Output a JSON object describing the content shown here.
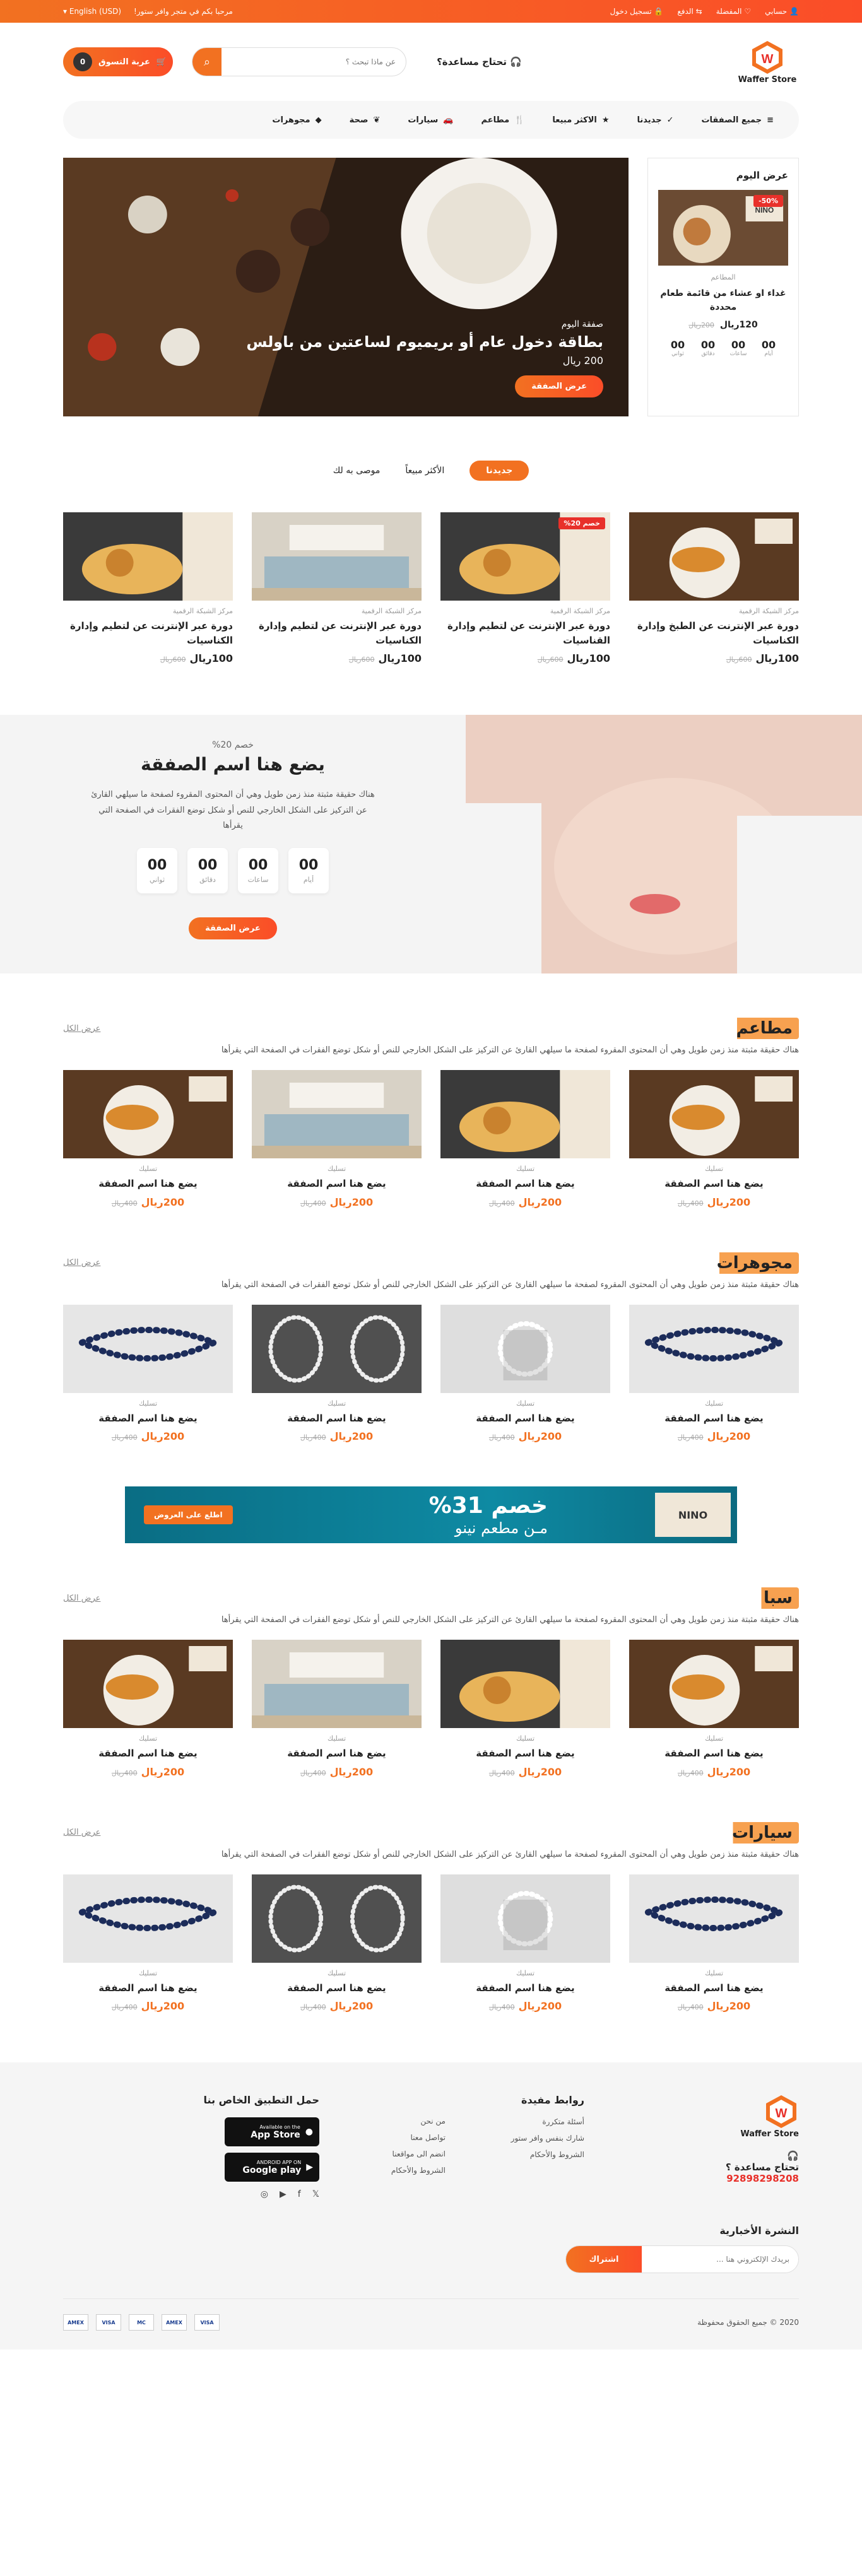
{
  "topbar": {
    "account": "حسابي",
    "favorites": "المفضلة",
    "pay": "الدفع",
    "login": "تسجيل دخول",
    "welcome": "مرحبا بكم في متجر وافر ستور!",
    "currency": "English (USD)"
  },
  "header": {
    "logo_text": "Waffer Store",
    "help": "تحتاج مساعدة؟",
    "search_placeholder": "عن ماذا تبحث ؟",
    "cart_label": "عربة التسوق",
    "cart_count": "0"
  },
  "nav": {
    "items": [
      {
        "label": "جميع الصفقات",
        "icon": "menu-icon"
      },
      {
        "label": "جديدنا",
        "icon": "check-icon"
      },
      {
        "label": "الاكثر مبيعا",
        "icon": "star-icon"
      },
      {
        "label": "مطاعم",
        "icon": "fork-knife-icon"
      },
      {
        "label": "سيارات",
        "icon": "car-icon"
      },
      {
        "label": "صحة",
        "icon": "leaf-icon"
      },
      {
        "label": "مجوهرات",
        "icon": "diamond-icon"
      }
    ]
  },
  "hero": {
    "offer_title": "عرض اليوم",
    "badge": "50%-",
    "offer_category": "المطاعم",
    "offer_name": "غداء او عشاء من قائمة طعام محددة",
    "offer_price": "120ريال",
    "offer_old": "200ريال",
    "countdown": [
      {
        "v": "00",
        "l": "أيام"
      },
      {
        "v": "00",
        "l": "ساعات"
      },
      {
        "v": "00",
        "l": "دقائق"
      },
      {
        "v": "00",
        "l": "ثواني"
      }
    ],
    "kicker": "صفقة اليوم",
    "headline": "بطاقة دخول عام أو بريميوم لساعتين من باولس",
    "price": "200 ريال",
    "button": "عرض الصفقة"
  },
  "tabs": [
    "جديدنا",
    "الأكثر مبيعاً",
    "موصى به لك"
  ],
  "featured": [
    {
      "cat": "مركز الشبكة الرقمية",
      "title": "دورة عبر الإنترنت عن الطبخ وإدارة الكناسيات",
      "price": "100ريال",
      "old": "600ريال",
      "badge": ""
    },
    {
      "cat": "مركز الشبكة الرقمية",
      "title": "دورة عبر الإنترنت عن لتطيم وإدارة القناسيات",
      "price": "100ريال",
      "old": "600ريال",
      "badge": "خصم 20%"
    },
    {
      "cat": "مركز الشبكة الرقمية",
      "title": "دورة عبر الإنترنت عن لتطيم وإدارة الكناسيات",
      "price": "100ريال",
      "old": "600ريال",
      "badge": ""
    },
    {
      "cat": "مركز الشبكة الرقمية",
      "title": "دورة عبر الإنترنت عن لتطيم وإدارة الكناسيات",
      "price": "100ريال",
      "old": "600ريال",
      "badge": ""
    }
  ],
  "deal": {
    "kicker": "خصم 20%",
    "title": "يضع هنا اسم الصفقة",
    "desc": "هناك حقيقة مثبتة منذ زمن طويل وهي أن المحتوى المقروء لصفحة ما سيلهي القارئ عن التركيز على الشكل الخارجي للنص أو شكل توضع الفقرات في الصفحة التي يقرأها",
    "countdown": [
      {
        "v": "00",
        "l": "أيام"
      },
      {
        "v": "00",
        "l": "ساعات"
      },
      {
        "v": "00",
        "l": "دقائق"
      },
      {
        "v": "00",
        "l": "ثواني"
      }
    ],
    "button": "عرض الصفقة"
  },
  "sections": [
    {
      "title": "مطاعم",
      "all": "عرض الكل",
      "desc": "هناك حقيقة مثبتة منذ زمن طويل وهي أن المحتوى المقروء لصفحة ما سيلهي القارئ عن التركيز على الشكل الخارجي للنص أو شكل توضع الفقرات في الصفحة التي يقرأها",
      "kind": "food",
      "items": [
        {
          "cat": "تسليك",
          "title": "يضع هنا اسم الصفقة",
          "price": "200ريال",
          "old": "400ريال"
        },
        {
          "cat": "تسليك",
          "title": "يضع هنا اسم الصفقة",
          "price": "200ريال",
          "old": "400ريال"
        },
        {
          "cat": "تسليك",
          "title": "يضع هنا اسم الصفقة",
          "price": "200ريال",
          "old": "400ريال"
        },
        {
          "cat": "تسليك",
          "title": "يضع هنا اسم الصفقة",
          "price": "200ريال",
          "old": "400ريال"
        }
      ]
    },
    {
      "title": "مجوهرات",
      "all": "عرض الكل",
      "desc": "هناك حقيقة مثبتة منذ زمن طويل وهي أن المحتوى المقروء لصفحة ما سيلهي القارئ عن التركيز على الشكل الخارجي للنص أو شكل توضع الفقرات في الصفحة التي يقرأها",
      "kind": "jewel",
      "items": [
        {
          "cat": "تسليك",
          "title": "يضع هنا اسم الصفقة",
          "price": "200ريال",
          "old": "400ريال"
        },
        {
          "cat": "تسليك",
          "title": "يضع هنا اسم الصفقة",
          "price": "200ريال",
          "old": "400ريال"
        },
        {
          "cat": "تسليك",
          "title": "يضع هنا اسم الصفقة",
          "price": "200ريال",
          "old": "400ريال"
        },
        {
          "cat": "تسليك",
          "title": "يضع هنا اسم الصفقة",
          "price": "200ريال",
          "old": "400ريال"
        }
      ]
    }
  ],
  "banner": {
    "title": "خصم 31%",
    "sub": "مـن مطعم نينو",
    "button": "اطلع على العروض",
    "logo": "NINO"
  },
  "sections2": [
    {
      "title": "سبا",
      "all": "عرض الكل",
      "desc": "هناك حقيقة مثبتة منذ زمن طويل وهي أن المحتوى المقروء لصفحة ما سيلهي القارئ عن التركيز على الشكل الخارجي للنص أو شكل توضع الفقرات في الصفحة التي يقرأها",
      "kind": "food",
      "items": [
        {
          "cat": "تسليك",
          "title": "يضع هنا اسم الصفقة",
          "price": "200ريال",
          "old": "400ريال"
        },
        {
          "cat": "تسليك",
          "title": "يضع هنا اسم الصفقة",
          "price": "200ريال",
          "old": "400ريال"
        },
        {
          "cat": "تسليك",
          "title": "يضع هنا اسم الصفقة",
          "price": "200ريال",
          "old": "400ريال"
        },
        {
          "cat": "تسليك",
          "title": "يضع هنا اسم الصفقة",
          "price": "200ريال",
          "old": "400ريال"
        }
      ]
    },
    {
      "title": "سيارات",
      "all": "عرض الكل",
      "desc": "هناك حقيقة مثبتة منذ زمن طويل وهي أن المحتوى المقروء لصفحة ما سيلهي القارئ عن التركيز على الشكل الخارجي للنص أو شكل توضع الفقرات في الصفحة التي يقرأها",
      "kind": "jewel",
      "items": [
        {
          "cat": "تسليك",
          "title": "يضع هنا اسم الصفقة",
          "price": "200ريال",
          "old": "400ريال"
        },
        {
          "cat": "تسليك",
          "title": "يضع هنا اسم الصفقة",
          "price": "200ريال",
          "old": "400ريال"
        },
        {
          "cat": "تسليك",
          "title": "يضع هنا اسم الصفقة",
          "price": "200ريال",
          "old": "400ريال"
        },
        {
          "cat": "تسليك",
          "title": "يضع هنا اسم الصفقة",
          "price": "200ريال",
          "old": "400ريال"
        }
      ]
    }
  ],
  "footer": {
    "help": "تحتاج مساعدة ؟",
    "phone": "92898298208",
    "links_title": "روابط مفيدة",
    "links": [
      "أسئلة متكررة",
      "شارك بنفس وافر ستور",
      "الشروط والأحكام"
    ],
    "links2": [
      "من نحن",
      "تواصل معنا",
      "انضم الى مواقعنا",
      "الشروط والأحكام"
    ],
    "app_title": "حمل التطبيق الخاص بنا",
    "appstore": "App Store",
    "appstore_small": "Available on the",
    "gplay": "Google play",
    "gplay_small": "ANDROID APP ON",
    "news_title": "النشرة الأخبارية",
    "news_placeholder": "بريدك الإلكتروني هنا ...",
    "news_button": "اشتراك",
    "copyright": "2020 © جميع الحقوق محفوظة",
    "pays": [
      "VISA",
      "AMEX",
      "MC",
      "VISA",
      "AMEX"
    ]
  }
}
